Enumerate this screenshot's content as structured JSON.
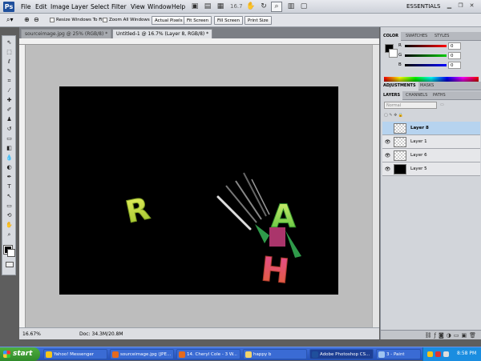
{
  "app": {
    "logo": "Ps",
    "menu": [
      "File",
      "Edit",
      "Image",
      "Layer",
      "Select",
      "Filter",
      "View",
      "Window",
      "Help"
    ],
    "zoom_readout": "16.7",
    "workspace": "ESSENTIALS"
  },
  "options_bar": {
    "resize_windows": "Resize Windows To Fit",
    "zoom_all_windows": "Zoom All Windows",
    "actual_pixels": "Actual Pixels",
    "fit_screen": "Fit Screen",
    "fill_screen": "Fill Screen",
    "print_size": "Print Size"
  },
  "document": {
    "tabs": [
      {
        "label": "sourceimage.jpg @ 25% (RGB/8) *",
        "active": false
      },
      {
        "label": "Untitled-1 @ 16.7% (Layer 8, RGB/8) *",
        "active": true
      }
    ],
    "status_zoom": "16.67%",
    "status_doc": "Doc: 34.3M/20.8M",
    "artwork": [
      "R",
      "A",
      "H"
    ]
  },
  "panels": {
    "color_tabs": [
      "COLOR",
      "SWATCHES",
      "STYLES"
    ],
    "rgb": [
      {
        "label": "R",
        "value": "0"
      },
      {
        "label": "G",
        "value": "0"
      },
      {
        "label": "B",
        "value": "0"
      }
    ],
    "adjust_tabs": [
      "ADJUSTMENTS",
      "MASKS"
    ],
    "layer_tabs": [
      "LAYERS",
      "CHANNELS",
      "PATHS"
    ],
    "blend_mode": "Normal",
    "layers": [
      {
        "name": "Layer 8",
        "selected": true,
        "visible": false,
        "thumb": "transparent"
      },
      {
        "name": "Layer 1",
        "selected": false,
        "visible": true,
        "thumb": "transparent"
      },
      {
        "name": "Layer 6",
        "selected": false,
        "visible": true,
        "thumb": "transparent"
      },
      {
        "name": "Layer 5",
        "selected": false,
        "visible": true,
        "thumb": "black"
      }
    ]
  },
  "taskbar": {
    "start": "start",
    "tasks": [
      {
        "label": "Yahoo! Messenger",
        "active": false
      },
      {
        "label": "sourceimage.jpg (JPE...",
        "active": false
      },
      {
        "label": "14. Cheryl Cole - 3 W...",
        "active": false
      },
      {
        "label": "happy b",
        "active": false
      },
      {
        "label": "Adobe Photoshop CS...",
        "active": true
      },
      {
        "label": "3 - Paint",
        "active": false
      }
    ],
    "clock": "8:58 PM"
  },
  "colors": {
    "accent": "#1f4f9c",
    "letter_green": "#c9e84a",
    "letter_red": "#d9483e",
    "selected_layer": "#b6d3ef"
  }
}
